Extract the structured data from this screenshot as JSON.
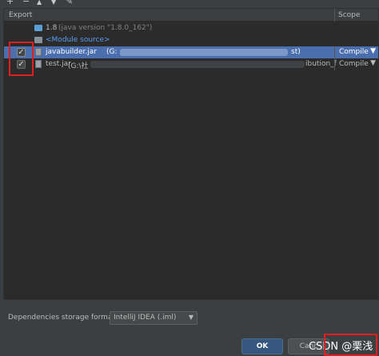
{
  "toolbar": {
    "add": "+",
    "remove": "−",
    "up": "▲",
    "down": "▼",
    "edit": "✎"
  },
  "table": {
    "headers": {
      "export": "Export",
      "scope": "Scope"
    },
    "rows": [
      {
        "name": "1.8",
        "detail": "(java version \"1.8.0_162\")"
      },
      {
        "name": "<Module source>"
      },
      {
        "name": "javabuilder.jar",
        "path_start": "(G:",
        "path_end": "st)",
        "scope": "Compile",
        "checked": "✓"
      },
      {
        "name": "test.jar",
        "path_start": "(G:\\社",
        "path_end": "ibution_f",
        "scope": "Compile",
        "checked": "✓"
      }
    ],
    "scope_arrow": "▼"
  },
  "footer": {
    "label": "Dependencies storage format:",
    "format_value": "IntelliJ IDEA (.iml)",
    "format_arrow": "▼",
    "ok": "OK",
    "cancel": "Canc"
  },
  "watermark": "CSDN @栗浅",
  "colors": {
    "selection": "#4b6eaf",
    "annotation_red": "#e0201e",
    "ok_button": "#365880"
  }
}
